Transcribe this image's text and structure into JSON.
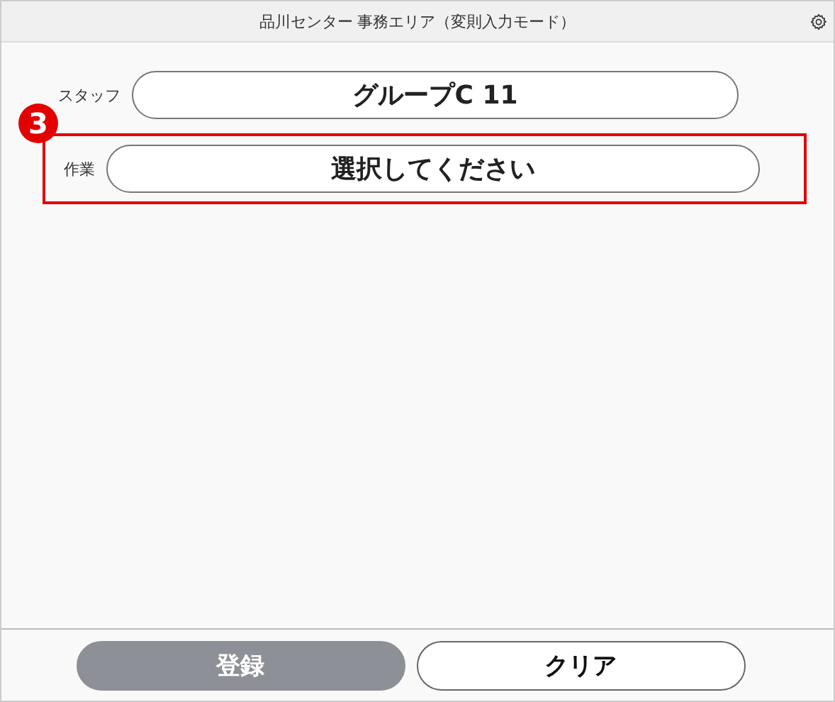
{
  "header": {
    "title": "品川センター 事務エリア（変則入力モード）"
  },
  "fields": [
    {
      "label": "スタッフ",
      "value": "グループC 11",
      "highlighted": false
    },
    {
      "label": "作業",
      "value": "選択してください",
      "highlighted": true
    }
  ],
  "annotation": {
    "number": "3"
  },
  "buttons": [
    {
      "label": "登録",
      "disabled": true
    },
    {
      "label": "クリア",
      "disabled": false
    }
  ]
}
